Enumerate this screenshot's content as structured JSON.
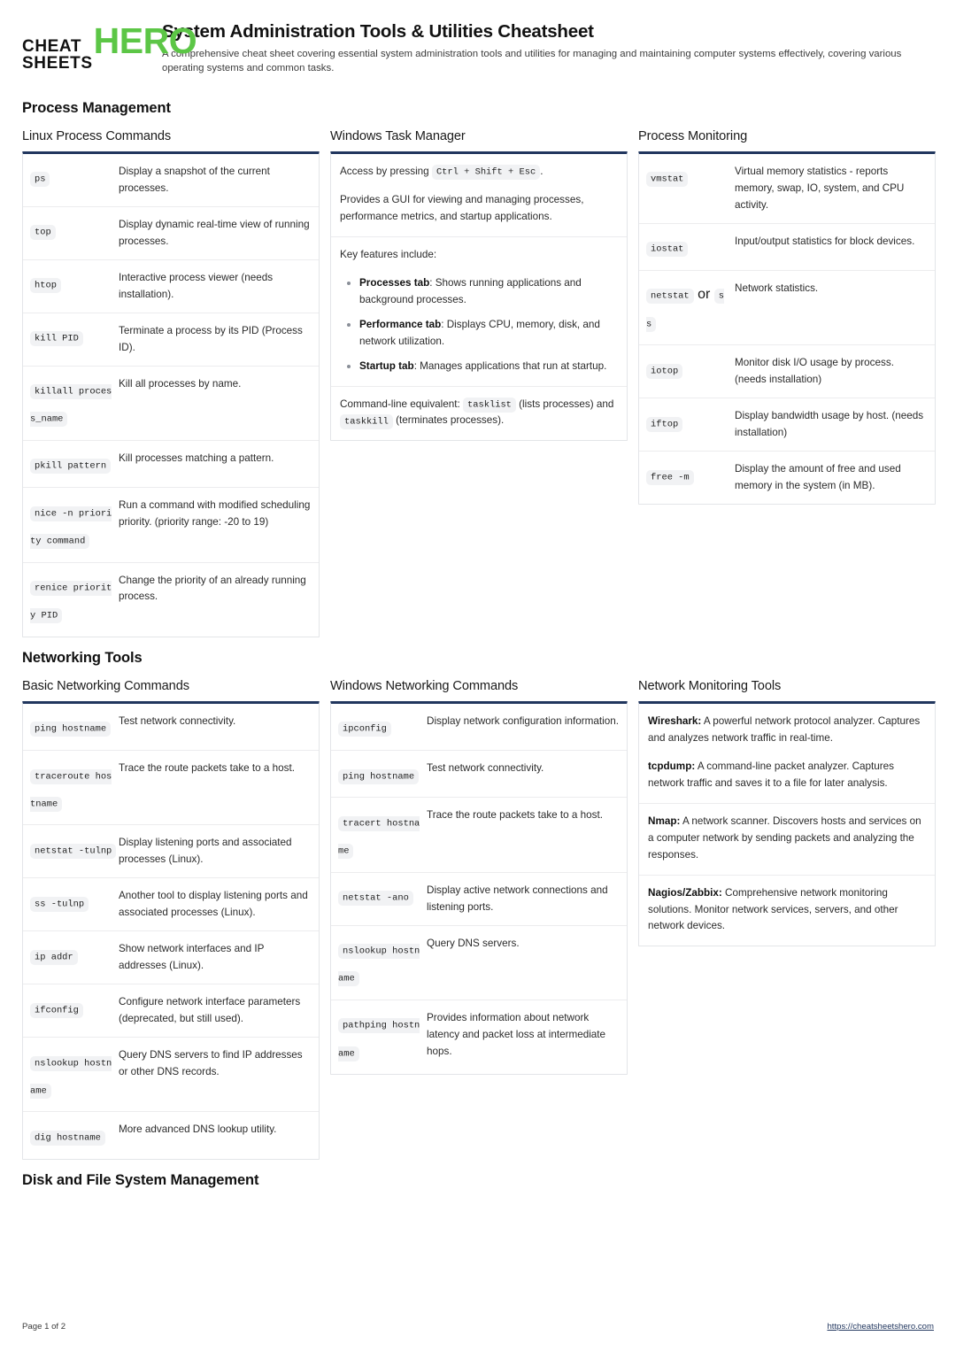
{
  "brand": {
    "logo_line1": "CHEAT",
    "logo_line2": "SHEETS",
    "logo_hero": "HERO",
    "accent_green": "#5cc646",
    "accent_navy": "#21365e"
  },
  "header": {
    "title": "System Administration Tools & Utilities Cheatsheet",
    "subtitle": "A comprehensive cheat sheet covering essential system administration tools and utilities for managing and maintaining computer systems effectively, covering various operating systems and common tasks."
  },
  "sections": [
    {
      "title": "Process Management"
    },
    {
      "title": "Networking Tools"
    },
    {
      "title": "Disk and File System Management"
    }
  ],
  "cards": {
    "linux_process": {
      "title": "Linux Process Commands",
      "rows": [
        {
          "code": "ps",
          "desc": "Display a snapshot of the current processes."
        },
        {
          "code": "top",
          "desc": "Display dynamic real-time view of running processes."
        },
        {
          "code": "htop",
          "desc": "Interactive process viewer (needs installation)."
        },
        {
          "code": "kill PID",
          "desc": "Terminate a process by its PID (Process ID)."
        },
        {
          "code": "killall process_name",
          "desc": "Kill all processes by name."
        },
        {
          "code": "pkill pattern",
          "desc": "Kill processes matching a pattern."
        },
        {
          "code": "nice -n priority command",
          "desc": "Run a command with modified scheduling priority. (priority range: -20 to 19)"
        },
        {
          "code": "renice priority PID",
          "desc": "Change the priority of an already running process."
        }
      ]
    },
    "windows_task_manager": {
      "title": "Windows Task Manager",
      "block1_pre": "Access by pressing ",
      "block1_code": "Ctrl + Shift + Esc",
      "block1_post": ".",
      "block1_para2": "Provides a GUI for viewing and managing processes, performance metrics, and startup applications.",
      "block2_intro": "Key features include:",
      "features": [
        {
          "label": "Processes tab",
          "text": ": Shows running applications and background processes."
        },
        {
          "label": "Performance tab",
          "text": ": Displays CPU, memory, disk, and network utilization."
        },
        {
          "label": "Startup tab",
          "text": ": Manages applications that run at startup."
        }
      ],
      "block3_pre": "Command-line equivalent: ",
      "block3_code1": "tasklist",
      "block3_mid": " (lists processes) and ",
      "block3_code2": "taskkill",
      "block3_post": " (terminates processes)."
    },
    "process_monitoring": {
      "title": "Process Monitoring",
      "rows": [
        {
          "code": "vmstat",
          "desc": "Virtual memory statistics - reports memory, swap, IO, system, and CPU activity."
        },
        {
          "code": "iostat",
          "desc": "Input/output statistics for block devices."
        },
        {
          "code": "netstat",
          "code2": "ss",
          "code_joiner": "or",
          "desc": "Network statistics."
        },
        {
          "code": "iotop",
          "desc": "Monitor disk I/O usage by process. (needs installation)"
        },
        {
          "code": "iftop",
          "desc": "Display bandwidth usage by host. (needs installation)"
        },
        {
          "code": "free -m",
          "desc": "Display the amount of free and used memory in the system (in MB)."
        }
      ]
    },
    "basic_networking": {
      "title": "Basic Networking Commands",
      "rows": [
        {
          "code": "ping hostname",
          "desc": "Test network connectivity."
        },
        {
          "code": "traceroute hostname",
          "desc": "Trace the route packets take to a host."
        },
        {
          "code": "netstat -tulnp",
          "desc": "Display listening ports and associated processes (Linux)."
        },
        {
          "code": "ss -tulnp",
          "desc": "Another tool to display listening ports and associated processes (Linux)."
        },
        {
          "code": "ip addr",
          "desc": "Show network interfaces and IP addresses (Linux)."
        },
        {
          "code": "ifconfig",
          "desc": "Configure network interface parameters (deprecated, but still used)."
        },
        {
          "code": "nslookup hostname",
          "desc": "Query DNS servers to find IP addresses or other DNS records."
        },
        {
          "code": "dig hostname",
          "desc": "More advanced DNS lookup utility."
        }
      ]
    },
    "windows_networking": {
      "title": "Windows Networking Commands",
      "rows": [
        {
          "code": "ipconfig",
          "desc": "Display network configuration information."
        },
        {
          "code": "ping hostname",
          "desc": "Test network connectivity."
        },
        {
          "code": "tracert hostname",
          "desc": "Trace the route packets take to a host."
        },
        {
          "code": "netstat -ano",
          "desc": "Display active network connections and listening ports."
        },
        {
          "code": "nslookup hostname",
          "desc": "Query DNS servers."
        },
        {
          "code": "pathping hostname",
          "desc": "Provides information about network latency and packet loss at intermediate hops."
        }
      ]
    },
    "network_monitoring": {
      "title": "Network Monitoring Tools",
      "blocks": [
        [
          {
            "label": "Wireshark:",
            "text": " A powerful network protocol analyzer. Captures and analyzes network traffic in real-time."
          },
          {
            "label": "tcpdump:",
            "text": " A command-line packet analyzer. Captures network traffic and saves it to a file for later analysis."
          }
        ],
        [
          {
            "label": "Nmap:",
            "text": " A network scanner. Discovers hosts and services on a computer network by sending packets and analyzing the responses."
          }
        ],
        [
          {
            "label": "Nagios/Zabbix:",
            "text": " Comprehensive network monitoring solutions. Monitor network services, servers, and other network devices."
          }
        ]
      ]
    }
  },
  "footer": {
    "page_label": "Page 1 of 2",
    "url": "https://cheatsheetshero.com"
  }
}
